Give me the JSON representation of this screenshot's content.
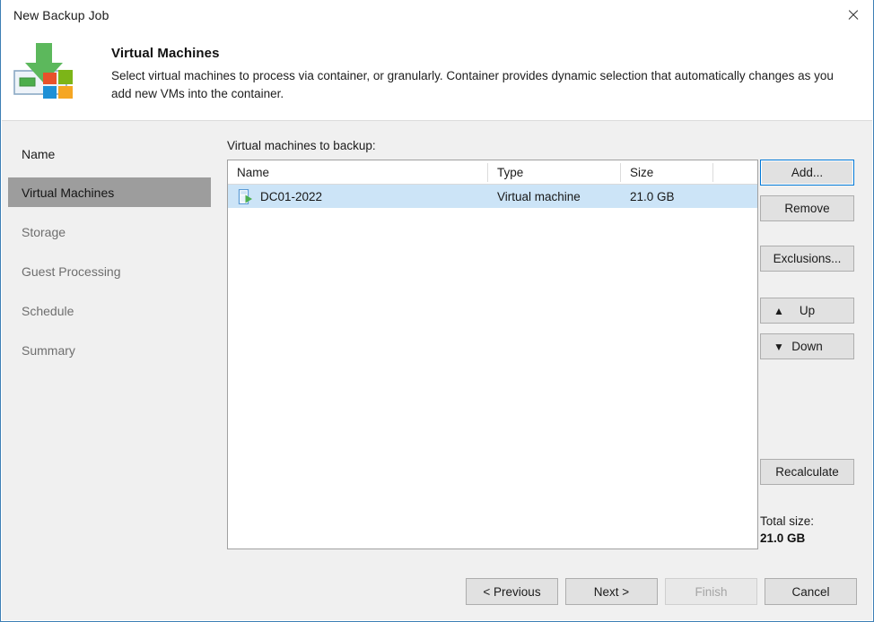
{
  "window": {
    "title": "New Backup Job",
    "close_icon": "close-icon"
  },
  "header": {
    "icon": "virtual-machines-banner-icon",
    "title": "Virtual Machines",
    "description": "Select virtual machines to process via container, or granularly. Container provides dynamic selection that automatically changes as you add new VMs into the container."
  },
  "sidebar": {
    "items": [
      {
        "label": "Name",
        "state": "visited"
      },
      {
        "label": "Virtual Machines",
        "state": "active"
      },
      {
        "label": "Storage",
        "state": "pending"
      },
      {
        "label": "Guest Processing",
        "state": "pending"
      },
      {
        "label": "Schedule",
        "state": "pending"
      },
      {
        "label": "Summary",
        "state": "pending"
      }
    ]
  },
  "main": {
    "list_label": "Virtual machines to backup:",
    "table": {
      "columns": [
        "Name",
        "Type",
        "Size"
      ],
      "rows": [
        {
          "icon": "virtual-machine-icon",
          "name": "DC01-2022",
          "type": "Virtual machine",
          "size": "21.0 GB",
          "selected": true
        }
      ]
    },
    "side_buttons": {
      "add": "Add...",
      "remove": "Remove",
      "exclusions": "Exclusions...",
      "up": "Up",
      "up_icon": "arrow-up-icon",
      "down": "Down",
      "down_icon": "arrow-down-icon",
      "recalculate": "Recalculate"
    },
    "total": {
      "label": "Total size:",
      "value": "21.0 GB"
    }
  },
  "footer": {
    "previous": "< Previous",
    "next": "Next >",
    "finish": "Finish",
    "cancel": "Cancel"
  },
  "colors": {
    "window_border": "#3d7fb5",
    "chrome": "#f0f0f0",
    "nav_active_bg": "#9d9d9d",
    "row_selected_bg": "#cce4f7",
    "focus_accent": "#0078d7",
    "icon_green": "#5cb85c",
    "icon_red": "#e8512a",
    "icon_blue": "#1e90d6",
    "icon_yellow": "#f5a623"
  }
}
